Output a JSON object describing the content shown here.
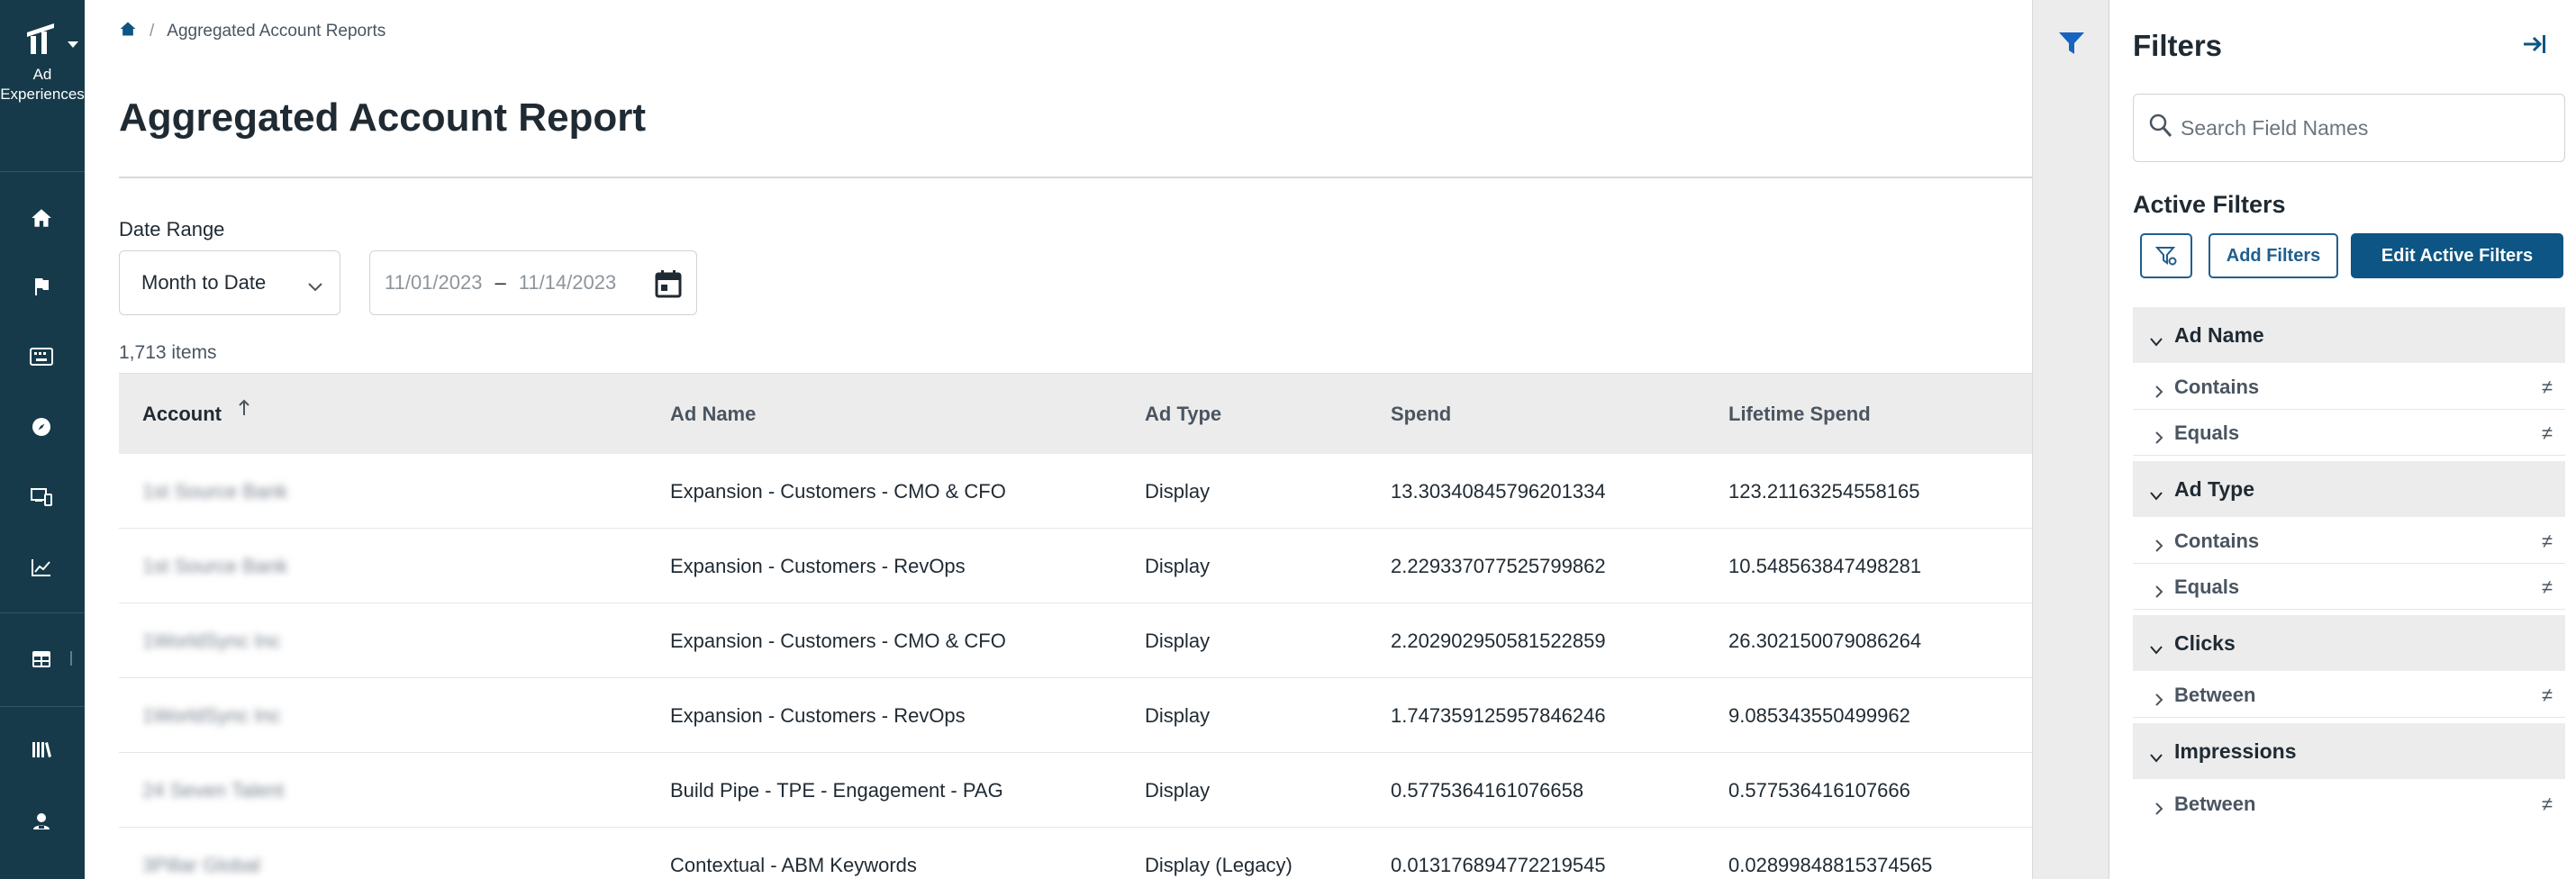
{
  "nav": {
    "brand_line1": "Ad",
    "brand_line2": "Experiences",
    "items": [
      {
        "icon": "home-icon"
      },
      {
        "icon": "flag-icon"
      },
      {
        "icon": "keyboard-icon"
      },
      {
        "icon": "compass-icon"
      },
      {
        "icon": "devices-icon"
      },
      {
        "icon": "line-chart-icon"
      },
      {
        "icon": "table-icon"
      },
      {
        "icon": "library-icon"
      },
      {
        "icon": "user-badge-icon"
      }
    ]
  },
  "breadcrumb": {
    "separator": "/",
    "current": "Aggregated Account Reports"
  },
  "page": {
    "title": "Aggregated Account Report",
    "date_range_label": "Date Range",
    "range_value": "Month to Date",
    "date_start": "11/01/2023",
    "date_dash": "–",
    "date_end": "11/14/2023",
    "items_count": "1,713 items"
  },
  "table": {
    "columns": [
      "Account",
      "Ad Name",
      "Ad Type",
      "Spend",
      "Lifetime Spend"
    ],
    "rows": [
      [
        "1st Source Bank",
        "Expansion - Customers - CMO & CFO",
        "Display",
        "13.30340845796201334",
        "123.21163254558165"
      ],
      [
        "1st Source Bank",
        "Expansion - Customers - RevOps",
        "Display",
        "2.229337077525799862",
        "10.548563847498281"
      ],
      [
        "1WorldSync Inc",
        "Expansion - Customers - CMO & CFO",
        "Display",
        "2.202902950581522859",
        "26.302150079086264"
      ],
      [
        "1WorldSync Inc",
        "Expansion - Customers - RevOps",
        "Display",
        "1.747359125957846246",
        "9.085343550499962"
      ],
      [
        "24 Seven Talent",
        "Build Pipe - TPE - Engagement - PAG",
        "Display",
        "0.5775364161076658",
        "0.577536416107666"
      ],
      [
        "3Pillar Global",
        "Contextual - ABM Keywords",
        "Display (Legacy)",
        "0.013176894772219545",
        "0.02899848815374565"
      ]
    ]
  },
  "filters": {
    "title": "Filters",
    "search_placeholder": "Search Field Names",
    "active_title": "Active Filters",
    "add_label": "Add Filters",
    "edit_label": "Edit Active Filters",
    "not_equal_symbol": "≠",
    "groups": [
      {
        "name": "Ad Name",
        "conditions": [
          "Contains",
          "Equals"
        ]
      },
      {
        "name": "Ad Type",
        "conditions": [
          "Contains",
          "Equals"
        ]
      },
      {
        "name": "Clicks",
        "conditions": [
          "Between"
        ]
      },
      {
        "name": "Impressions",
        "conditions": [
          "Between"
        ]
      }
    ]
  },
  "colors": {
    "nav_bg": "#163a4a",
    "primary": "#0d5584",
    "accent_blue": "#1565c0"
  }
}
